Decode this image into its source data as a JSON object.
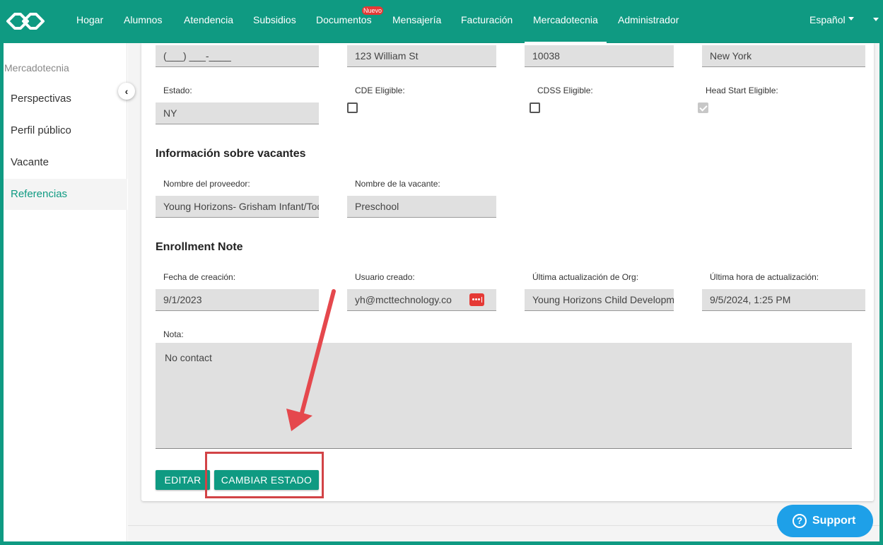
{
  "nav": {
    "items": [
      "Hogar",
      "Alumnos",
      "Atendencia",
      "Subsidios",
      "Documentos",
      "Mensajería",
      "Facturación",
      "Mercadotecnia",
      "Administrador"
    ],
    "badge": "Nuevo",
    "language": "Español"
  },
  "sidebar": {
    "title": "Mercadotecnia",
    "items": [
      "Perspectivas",
      "Perfil público",
      "Vacante",
      "Referencias"
    ]
  },
  "address": {
    "phone": "(___) ___-____",
    "street": "123 William St",
    "zip": "10038",
    "city": "New York"
  },
  "state": {
    "label": "Estado:",
    "value": "NY"
  },
  "eligibility": {
    "cde_label": "CDE Eligible:",
    "cdss_label": "CDSS Eligible:",
    "head_start_label": "Head Start Eligible:"
  },
  "vacancy": {
    "title": "Información sobre vacantes",
    "provider_label": "Nombre del proveedor:",
    "provider_value": "Young Horizons- Grisham Infant/Toddler",
    "vacancy_label": "Nombre de la vacante:",
    "vacancy_value": "Preschool"
  },
  "enrollment": {
    "title": "Enrollment Note",
    "created_label": "Fecha de creación:",
    "created_value": "9/1/2023",
    "user_label": "Usuario creado:",
    "user_value": "yh@mcttechnology.co",
    "org_label": "Última actualización de Org:",
    "org_value": "Young Horizons Child Development",
    "time_label": "Última hora de actualización:",
    "time_value": "9/5/2024, 1:25 PM",
    "note_label": "Nota:",
    "note_value": "No contact"
  },
  "buttons": {
    "edit": "EDITAR",
    "change_status": "CAMBIAR ESTADO"
  },
  "support": {
    "label": "Support"
  },
  "colors": {
    "brand": "#0f9a82",
    "annotation": "#d24346",
    "support": "#1ea0e8"
  }
}
